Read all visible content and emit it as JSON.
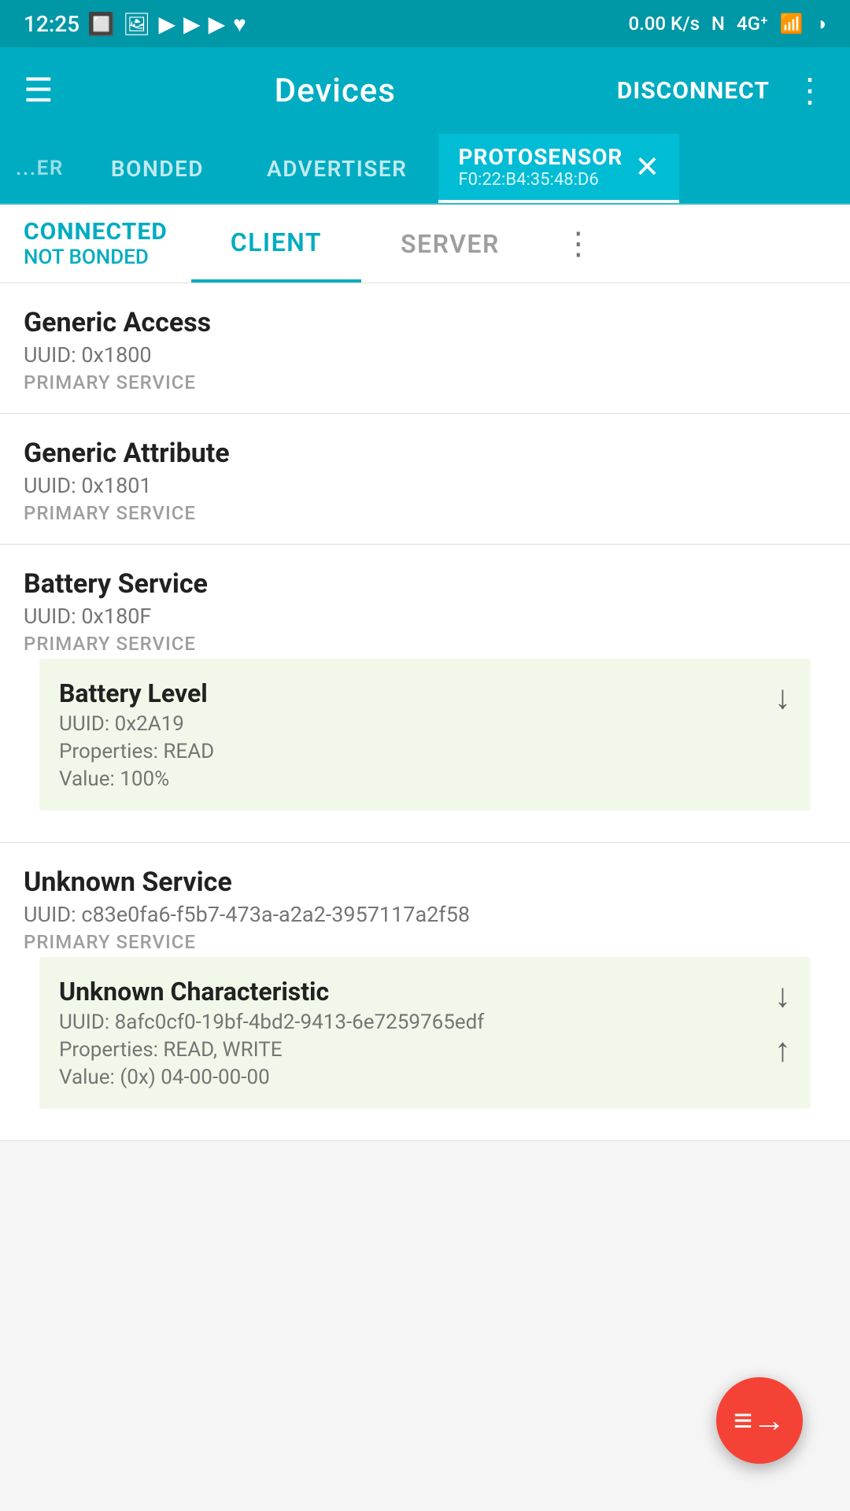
{
  "status_bar": {
    "time": "12:25",
    "speed": "0.00 K/s"
  },
  "app_bar": {
    "hamburger_label": "☰",
    "title": "Devices",
    "disconnect_label": "DISCONNECT",
    "more_label": "⋮"
  },
  "tabs": {
    "items": [
      {
        "id": "scanner",
        "label": "ER",
        "partial": true
      },
      {
        "id": "bonded",
        "label": "BONDED"
      },
      {
        "id": "advertiser",
        "label": "ADVERTISER"
      },
      {
        "id": "protosensor",
        "label": "PROTOSENSOR",
        "subtitle": "F0:22:B4:35:48:D6",
        "active": true
      }
    ]
  },
  "sub_header": {
    "connected": "CONNECTED",
    "not_bonded": "NOT BONDED",
    "client_tab": "CLIENT",
    "server_tab": "SERVER",
    "more": "⋮"
  },
  "services": [
    {
      "id": "generic-access",
      "name": "Generic Access",
      "uuid_label": "UUID:",
      "uuid": "0x1800",
      "type": "PRIMARY SERVICE",
      "characteristics": []
    },
    {
      "id": "generic-attribute",
      "name": "Generic Attribute",
      "uuid_label": "UUID:",
      "uuid": "0x1801",
      "type": "PRIMARY SERVICE",
      "characteristics": []
    },
    {
      "id": "battery-service",
      "name": "Battery Service",
      "uuid_label": "UUID:",
      "uuid": "0x180F",
      "type": "PRIMARY SERVICE",
      "characteristics": [
        {
          "id": "battery-level",
          "name": "Battery Level",
          "uuid_label": "UUID:",
          "uuid": "0x2A19",
          "props_label": "Properties:",
          "props": "READ",
          "value_label": "Value:",
          "value": "100%",
          "actions": [
            "download"
          ]
        }
      ]
    },
    {
      "id": "unknown-service",
      "name": "Unknown Service",
      "uuid_label": "UUID:",
      "uuid": "c83e0fa6-f5b7-473a-a2a2-3957117a2f58",
      "type": "PRIMARY SERVICE",
      "characteristics": [
        {
          "id": "unknown-characteristic",
          "name": "Unknown Characteristic",
          "uuid_label": "UUID:",
          "uuid": "8afc0cf0-19bf-4bd2-9413-6e7259765edf",
          "props_label": "Properties:",
          "props": "READ, WRITE",
          "value_label": "Value:",
          "value": "(0x) 04-00-00-00",
          "actions": [
            "download",
            "upload"
          ]
        }
      ]
    }
  ],
  "fab": {
    "icon": "≡→"
  }
}
